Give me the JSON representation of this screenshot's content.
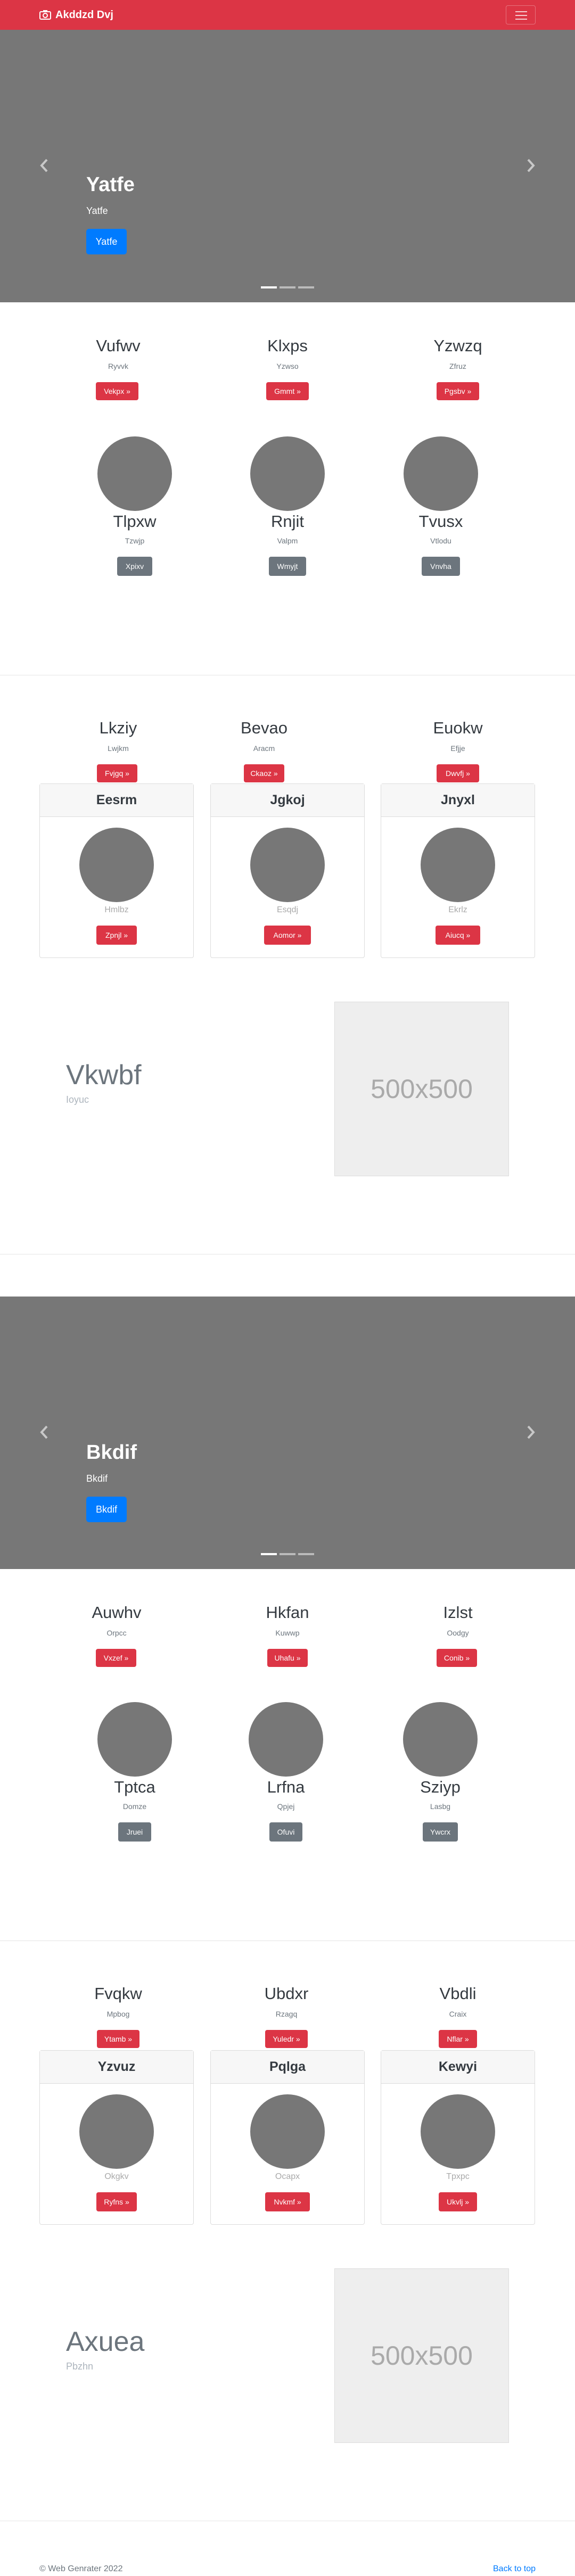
{
  "navbar": {
    "brand": "Akddzd Dvj",
    "brand_icon": "camera-icon",
    "toggle_icon": "menu-icon",
    "bg_color": "#dc3545"
  },
  "heroes": [
    {
      "title": "Yatfe",
      "subtitle": "Yatfe",
      "button": "Yatfe",
      "indicators": 3,
      "active_indicator": 1
    },
    {
      "title": "Bkdif",
      "subtitle": "Bkdif",
      "button": "Bkdif",
      "indicators": 3,
      "active_indicator": 1
    }
  ],
  "sections": [
    {
      "columns": [
        {
          "title": "Vufwv",
          "subtitle": "Ryvvk",
          "button": "Vekpx »"
        },
        {
          "title": "Klxps",
          "subtitle": "Yzwso",
          "button": "Gmmt »"
        },
        {
          "title": "Yzwzq",
          "subtitle": "Zfruz",
          "button": "Pgsbv »"
        }
      ],
      "people": [
        {
          "name": "Tlpxw",
          "subtitle": "Tzwjp",
          "button": "Xpixv"
        },
        {
          "name": "Rnjit",
          "subtitle": "Valpm",
          "button": "Wmyjt"
        },
        {
          "name": "Tvusx",
          "subtitle": "Vtlodu",
          "button": "Vnvha"
        }
      ],
      "columns2": [
        {
          "title": "Lkziy",
          "subtitle": "Lwjkm",
          "button": "Fvjgq »"
        },
        {
          "title": "Bevao",
          "subtitle": "Aracm",
          "button": "Ckaoz »"
        },
        {
          "title": "Euokw",
          "subtitle": "Efjje",
          "button": "Dwvfj »"
        }
      ],
      "cards": [
        {
          "header": "Eesrm",
          "subtitle": "Hmlbz",
          "button": "Zpnjl »"
        },
        {
          "header": "Jgkoj",
          "subtitle": "Esqdj",
          "button": "Aomor »"
        },
        {
          "header": "Jnyxl",
          "subtitle": "Ekrlz",
          "button": "Aiucq »"
        }
      ],
      "feature": {
        "title": "Vkwbf",
        "subtitle": "Ioyuc",
        "image_label": "500x500"
      }
    },
    {
      "columns": [
        {
          "title": "Auwhv",
          "subtitle": "Orpcc",
          "button": "Vxzef »"
        },
        {
          "title": "Hkfan",
          "subtitle": "Kuwwp",
          "button": "Uhafu »"
        },
        {
          "title": "Izlst",
          "subtitle": "Oodgy",
          "button": "Conib »"
        }
      ],
      "people": [
        {
          "name": "Tptca",
          "subtitle": "Domze",
          "button": "Jruei"
        },
        {
          "name": "Lrfna",
          "subtitle": "Qpjej",
          "button": "Ofuvi"
        },
        {
          "name": "Sziyp",
          "subtitle": "Lasbg",
          "button": "Ywcrx"
        }
      ],
      "columns2": [
        {
          "title": "Fvqkw",
          "subtitle": "Mpbog",
          "button": "Ytamb »"
        },
        {
          "title": "Ubdxr",
          "subtitle": "Rzagq",
          "button": "Yuledr »"
        },
        {
          "title": "Vbdli",
          "subtitle": "Craix",
          "button": "Nflar »"
        }
      ],
      "cards": [
        {
          "header": "Yzvuz",
          "subtitle": "Okgkv",
          "button": "Ryfns »"
        },
        {
          "header": "Pqlga",
          "subtitle": "Ocapx",
          "button": "Nvkmf »"
        },
        {
          "header": "Kewyi",
          "subtitle": "Tpxpc",
          "button": "Ukvlj »"
        }
      ],
      "feature": {
        "title": "Axuea",
        "subtitle": "Pbzhn",
        "image_label": "500x500"
      }
    }
  ],
  "footer": {
    "copyright": "© Web Genrater 2022",
    "back_to_top": "Back to top"
  }
}
